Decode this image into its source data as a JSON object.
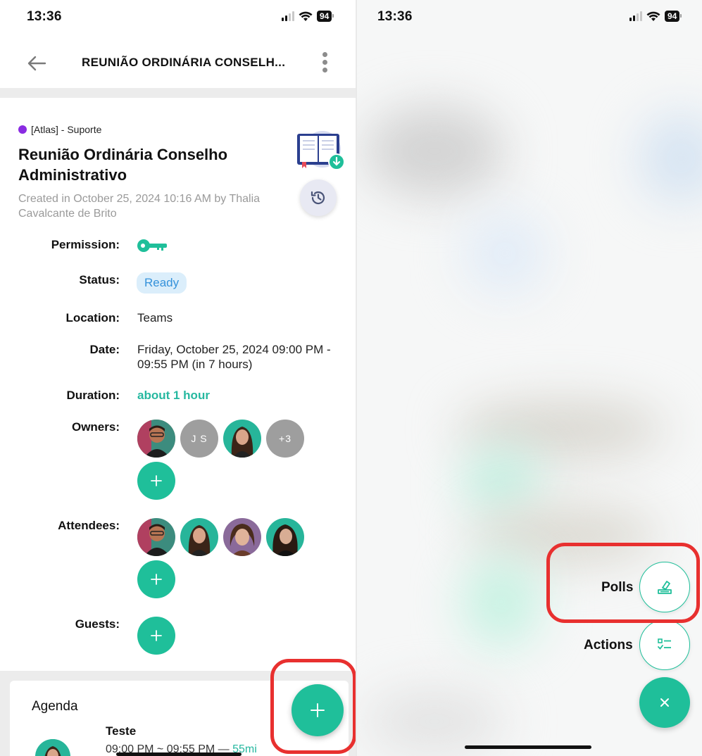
{
  "left": {
    "status_bar": {
      "time": "13:36",
      "battery": "94"
    },
    "header": {
      "title": "REUNIÃO ORDINÁRIA CONSELH..."
    },
    "meeting": {
      "tag": "[Atlas] - Suporte",
      "tag_color": "#8a2be2",
      "title": "Reunião Ordinária Conselho Administrativo",
      "created": "Created in October 25, 2024 10:16 AM by Thalia Cavalcante de Brito"
    },
    "fields": {
      "permission_label": "Permission:",
      "status_label": "Status:",
      "status_value": "Ready",
      "location_label": "Location:",
      "location_value": "Teams",
      "date_label": "Date:",
      "date_value": "Friday, October 25, 2024 09:00 PM - 09:55 PM (in 7 hours)",
      "duration_label": "Duration:",
      "duration_value": "about 1 hour",
      "owners_label": "Owners:",
      "owners": [
        {
          "type": "photo"
        },
        {
          "type": "initials",
          "text": "J S"
        },
        {
          "type": "photo"
        },
        {
          "type": "more",
          "text": "+3"
        }
      ],
      "attendees_label": "Attendees:",
      "guests_label": "Guests:"
    },
    "agenda": {
      "title": "Agenda",
      "item_title": "Teste",
      "item_time": "09:00 PM ~ 09:55 PM — ",
      "item_duration": "55mi"
    }
  },
  "right": {
    "status_bar": {
      "time": "13:36",
      "battery": "94"
    },
    "speed_dial": {
      "polls_label": "Polls",
      "actions_label": "Actions"
    }
  },
  "colors": {
    "accent": "#1fbf9a",
    "status_pill_bg": "#dbeefb",
    "status_pill_text": "#3592db",
    "highlight": "#e8302f"
  },
  "icons": [
    "back-arrow-icon",
    "more-vertical-icon",
    "book-download-icon",
    "history-icon",
    "key-icon",
    "plus-icon",
    "ballot-icon",
    "checklist-icon",
    "close-icon"
  ]
}
